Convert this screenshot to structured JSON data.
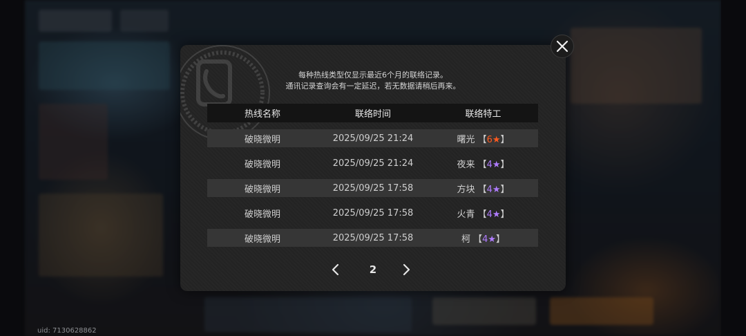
{
  "notice": {
    "line1": "每种热线类型仅显示最近6个月的联络记录。",
    "line2": "通讯记录查询会有一定延迟，若无数据请稍后再来。"
  },
  "table": {
    "headers": [
      "热线名称",
      "联络时间",
      "联络特工"
    ],
    "rows": [
      {
        "hotline": "破晓微明",
        "time": "2025/09/25 21:24",
        "agent": "曙光",
        "rank": "6",
        "star": "★",
        "star_color": "#ff5a1f"
      },
      {
        "hotline": "破晓微明",
        "time": "2025/09/25 21:24",
        "agent": "夜来",
        "rank": "4",
        "star": "★",
        "star_color": "#b07cff"
      },
      {
        "hotline": "破晓微明",
        "time": "2025/09/25 17:58",
        "agent": "方块",
        "rank": "4",
        "star": "★",
        "star_color": "#b07cff"
      },
      {
        "hotline": "破晓微明",
        "time": "2025/09/25 17:58",
        "agent": "火青",
        "rank": "4",
        "star": "★",
        "star_color": "#b07cff"
      },
      {
        "hotline": "破晓微明",
        "time": "2025/09/25 17:58",
        "agent": "柯",
        "rank": "4",
        "star": "★",
        "star_color": "#b07cff"
      }
    ]
  },
  "pager": {
    "current_page": "2",
    "prev_icon": "chevron-left-icon",
    "next_icon": "chevron-right-icon"
  },
  "close_icon": "close-icon",
  "uid_text": "uid: 7130628862",
  "colors": {
    "dialog_bg": "#242424",
    "header_bg": "#141414",
    "row_alt_bg": "#363636",
    "rank6": "#ff5a1f",
    "rank4": "#b07cff"
  }
}
